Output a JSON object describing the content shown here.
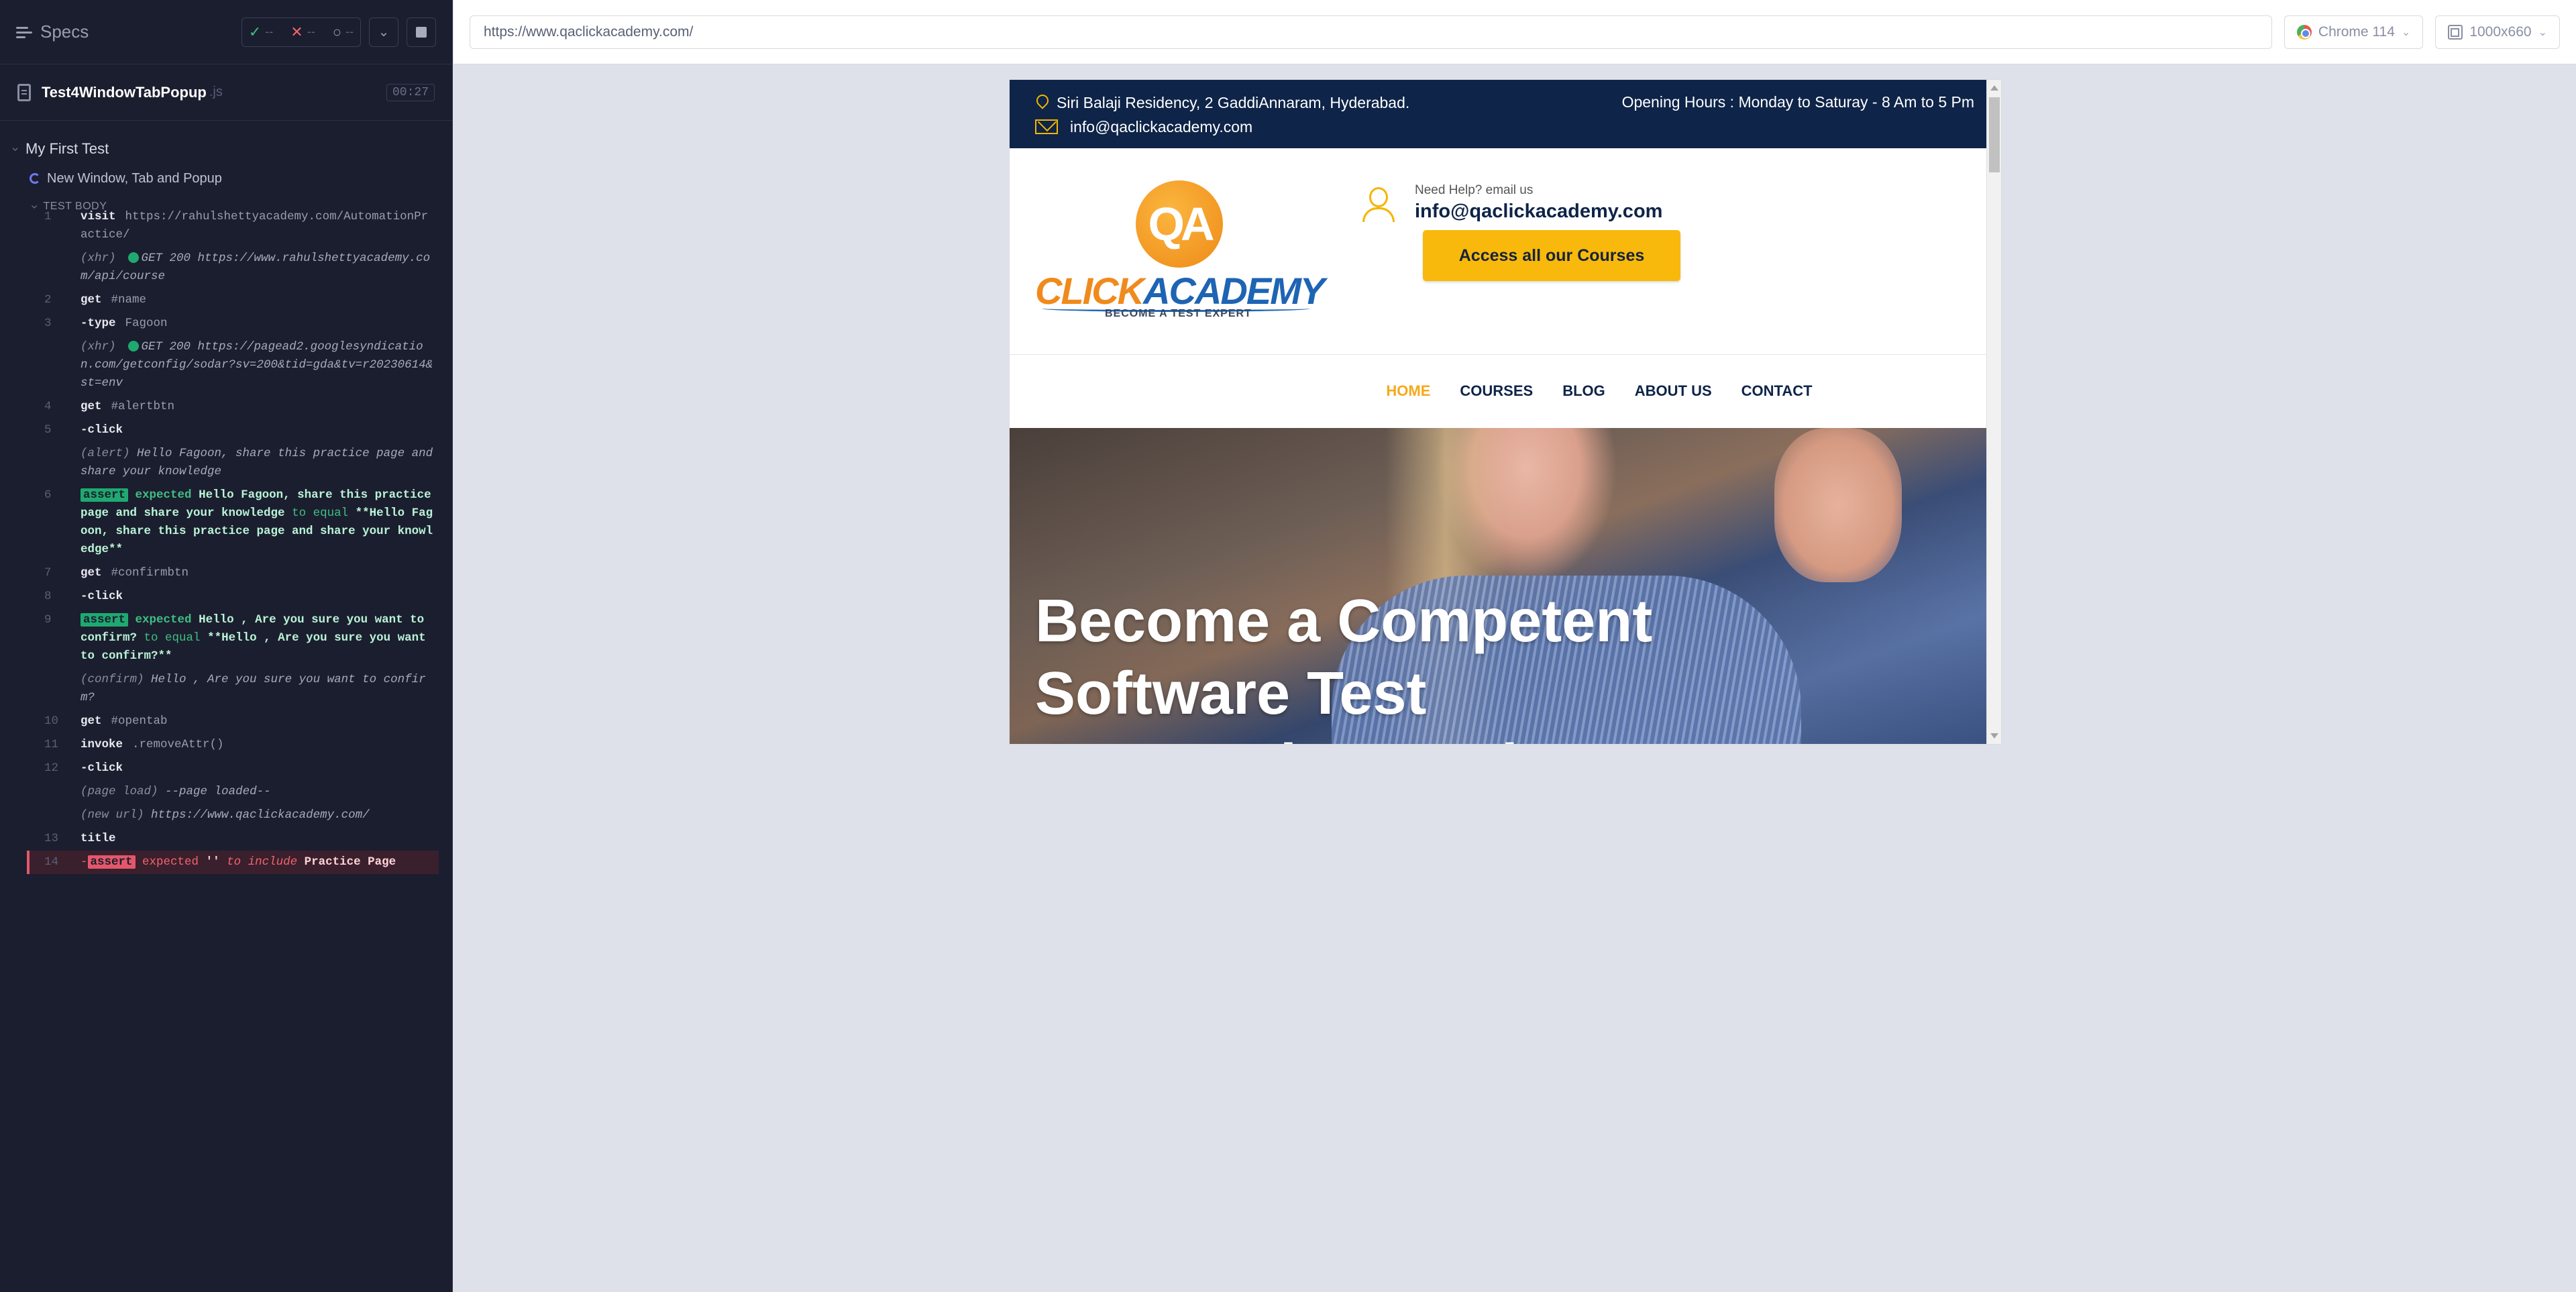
{
  "reporter": {
    "specs_label": "Specs",
    "stats": {
      "passed": "--",
      "failed": "--",
      "pending": "--"
    },
    "spec": {
      "name": "Test4WindowTabPopup",
      "ext": ".js",
      "duration": "00:27"
    },
    "suite": "My First Test",
    "test": "New Window, Tab and Popup",
    "body_label": "TEST BODY",
    "commands": [
      {
        "num": "1",
        "name": "visit",
        "msg": "https://rahulshettyacademy.com/AutomationPractice/"
      },
      {
        "event": "(xhr)",
        "status": "GET 200",
        "url": "https://www.rahulshettyacademy.com/api/course"
      },
      {
        "num": "2",
        "name": "get",
        "msg": "#name"
      },
      {
        "num": "3",
        "name": "-type",
        "msg": "Fagoon"
      },
      {
        "event": "(xhr)",
        "status": "GET 200",
        "url": "https://pagead2.googlesyndication.com/getconfig/sodar?sv=200&tid=gda&tv=r20230614&st=env"
      },
      {
        "num": "4",
        "name": "get",
        "msg": "#alertbtn"
      },
      {
        "num": "5",
        "name": "-click",
        "msg": ""
      },
      {
        "event": "(alert)",
        "msg": "Hello Fagoon, share this practice page and share your knowledge"
      },
      {
        "num": "6",
        "badge": "assert",
        "expected": "expected",
        "actual": "Hello Fagoon, share this practice page and share your knowledge",
        "op": "to equal",
        "target": "**Hello Fagoon, share this practice page and share your knowledge**"
      },
      {
        "num": "7",
        "name": "get",
        "msg": "#confirmbtn"
      },
      {
        "num": "8",
        "name": "-click",
        "msg": ""
      },
      {
        "num": "9",
        "badge": "assert",
        "expected": "expected",
        "actual": "Hello , Are you sure you want to confirm?",
        "op": "to equal",
        "target": "**Hello , Are you sure you want to confirm?**"
      },
      {
        "event": "(confirm)",
        "msg": "Hello , Are you sure you want to confirm?"
      },
      {
        "num": "10",
        "name": "get",
        "msg": "#opentab"
      },
      {
        "num": "11",
        "name": "invoke",
        "msg": ".removeAttr()"
      },
      {
        "num": "12",
        "name": "-click",
        "msg": ""
      },
      {
        "event": "(page load)",
        "msg": "--page loaded--"
      },
      {
        "event": "(new url)",
        "msg": "https://www.qaclickacademy.com/"
      },
      {
        "num": "13",
        "name": "title",
        "msg": ""
      },
      {
        "num": "14",
        "prefix": "-",
        "badge": "assert",
        "expected": "expected",
        "actual": "''",
        "op": "to include",
        "target": "Practice Page",
        "failed": true
      }
    ]
  },
  "browser": {
    "url": "https://www.qaclickacademy.com/",
    "browser_label": "Chrome 114",
    "viewport_label": "1000x660"
  },
  "site": {
    "address": "Siri Balaji Residency, 2 GaddiAnnaram, Hyderabad.",
    "email": "info@qaclickacademy.com",
    "hours": "Opening Hours : Monday to Saturay - 8 Am to 5 Pm",
    "logo_letters": "QA",
    "logo_word_1": "CLICK",
    "logo_word_2": "ACADEMY",
    "logo_tagline": "BECOME A TEST EXPERT",
    "help_text": "Need Help? email us",
    "help_email": "info@qaclickacademy.com",
    "cta": "Access all our Courses",
    "nav": [
      "HOME",
      "COURSES",
      "BLOG",
      "ABOUT US",
      "CONTACT"
    ],
    "hero_line_1": "Become a Competent",
    "hero_line_2": "Software Test",
    "hero_line_3": "Automation Engineer"
  },
  "colors": {
    "reporter_bg": "#1b1e2e",
    "pass": "#1fa971",
    "fail": "#e4576b",
    "navy": "#0e2448",
    "accent": "#f8b90c"
  }
}
